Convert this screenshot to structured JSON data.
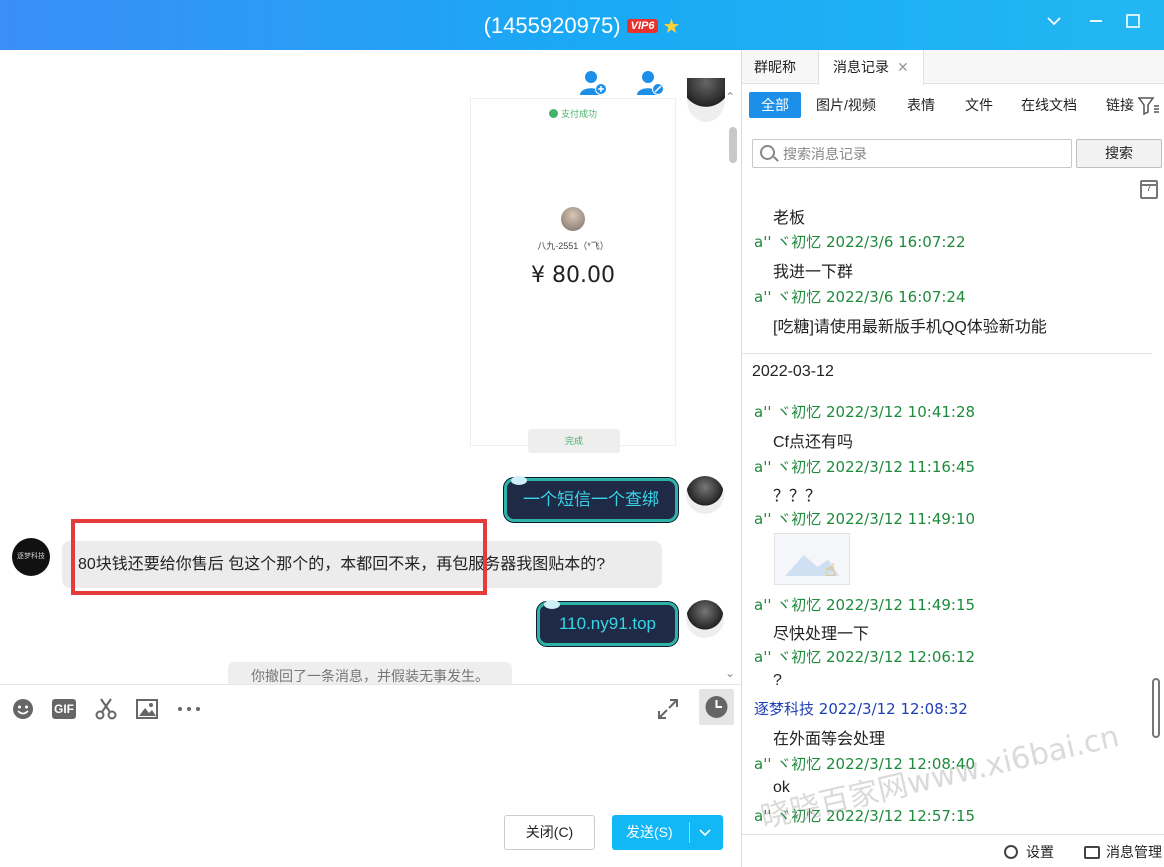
{
  "window": {
    "title": "(1455920975)",
    "vip_badge": "VIP6",
    "star_icon": "star-icon"
  },
  "chat": {
    "receipt": {
      "status": "支付成功",
      "name": "八九-2551（*飞）",
      "amount": "¥ 80.00",
      "done_label": "完成"
    },
    "messages": [
      {
        "from": "me",
        "text": "一个短信一个查绑"
      },
      {
        "from": "other",
        "text": "80块钱还要给你售后 包这个那个的，本都回不来，再包服务器我图贴本的?"
      },
      {
        "from": "me",
        "text": "110.ny91.top"
      }
    ],
    "recall_notice": "你撤回了一条消息，并假装无事发生。",
    "other_avatar_text": "逐梦科技"
  },
  "input": {
    "close_label": "关闭(C)",
    "send_label": "发送(S)"
  },
  "right_panel": {
    "tabs": [
      {
        "label": "群昵称"
      },
      {
        "label": "消息记录"
      }
    ],
    "filters": [
      "全部",
      "图片/视频",
      "表情",
      "文件",
      "在线文档",
      "链接"
    ],
    "search_placeholder": "搜索消息记录",
    "search_button": "搜索",
    "calendar_day": "7",
    "records": [
      {
        "type": "text",
        "text": "老板"
      },
      {
        "type": "head",
        "sender": "a'' ヾ初忆",
        "time": "2022/3/6 16:07:22"
      },
      {
        "type": "text",
        "text": "我进一下群"
      },
      {
        "type": "head",
        "sender": "a'' ヾ初忆",
        "time": "2022/3/6 16:07:24"
      },
      {
        "type": "text",
        "text": "[吃糖]请使用最新版手机QQ体验新功能"
      },
      {
        "type": "date",
        "text": "2022-03-12"
      },
      {
        "type": "head",
        "sender": "a'' ヾ初忆",
        "time": "2022/3/12 10:41:28"
      },
      {
        "type": "text",
        "text": "Cf点还有吗"
      },
      {
        "type": "head",
        "sender": "a'' ヾ初忆",
        "time": "2022/3/12 11:16:45"
      },
      {
        "type": "text",
        "text": "？？？"
      },
      {
        "type": "head",
        "sender": "a'' ヾ初忆",
        "time": "2022/3/12 11:49:10"
      },
      {
        "type": "image"
      },
      {
        "type": "head",
        "sender": "a'' ヾ初忆",
        "time": "2022/3/12 11:49:15"
      },
      {
        "type": "text",
        "text": "尽快处理一下"
      },
      {
        "type": "head",
        "sender": "a'' ヾ初忆",
        "time": "2022/3/12 12:06:12"
      },
      {
        "type": "text",
        "text": "?"
      },
      {
        "type": "head",
        "sender": "逐梦科技",
        "time": "2022/3/12 12:08:32",
        "self": true
      },
      {
        "type": "text",
        "text": "在外面等会处理"
      },
      {
        "type": "head",
        "sender": "a'' ヾ初忆",
        "time": "2022/3/12 12:08:40"
      },
      {
        "type": "text",
        "text": "ok"
      },
      {
        "type": "head",
        "sender": "a'' ヾ初忆",
        "time": "2022/3/12 12:57:15"
      }
    ],
    "footer": {
      "settings_label": "设置",
      "manage_label": "消息管理"
    }
  },
  "watermark": "晓晓百家网www.xi6bai.cn",
  "colors": {
    "titlebar": "#1aa9f5",
    "accent": "#1c8fe8",
    "sender_green": "#1e8a3c",
    "sender_self_blue": "#1d3fb8",
    "highlight_red": "#e63b3b"
  }
}
